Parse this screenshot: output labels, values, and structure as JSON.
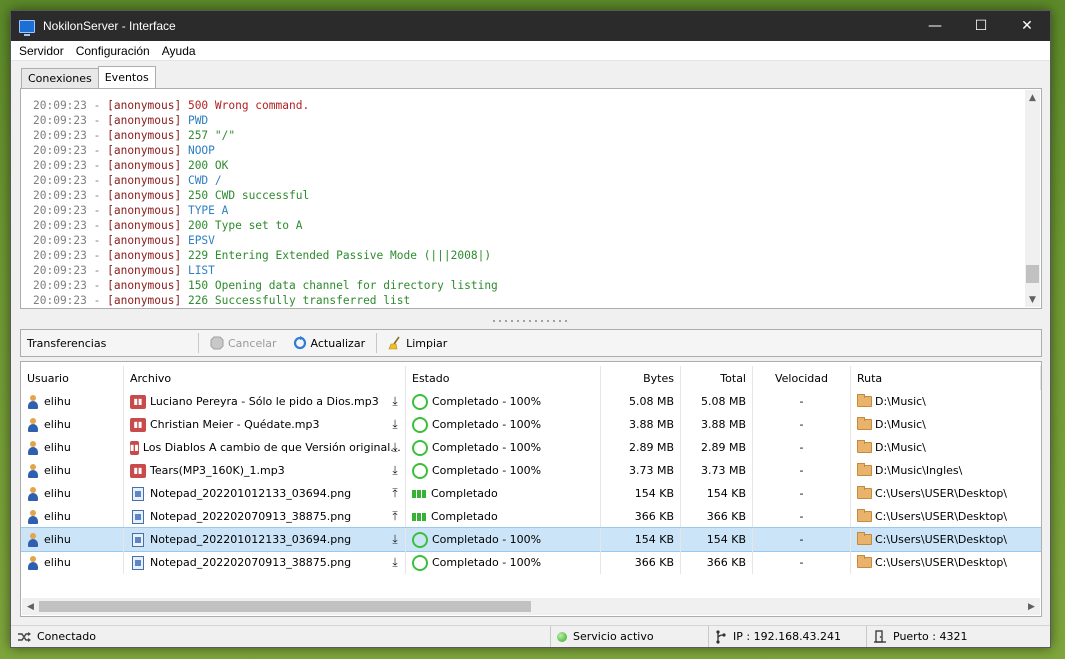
{
  "window": {
    "title": "NokilonServer - Interface",
    "minimize": "—",
    "maximize": "☐",
    "close": "✕"
  },
  "menu": [
    "Servidor",
    "Configuración",
    "Ayuda"
  ],
  "tabs": [
    {
      "label": "Conexiones",
      "active": false
    },
    {
      "label": "Eventos",
      "active": true
    }
  ],
  "log": [
    {
      "time": "20:09:23 -",
      "user": "[anonymous]",
      "msg": "500 Wrong command.",
      "kind": "err"
    },
    {
      "time": "20:09:23 -",
      "user": "[anonymous]",
      "msg": "PWD",
      "kind": "cmd"
    },
    {
      "time": "20:09:23 -",
      "user": "[anonymous]",
      "msg": "257 \"/\"",
      "kind": "ok"
    },
    {
      "time": "20:09:23 -",
      "user": "[anonymous]",
      "msg": "NOOP",
      "kind": "cmd"
    },
    {
      "time": "20:09:23 -",
      "user": "[anonymous]",
      "msg": "200 OK",
      "kind": "ok"
    },
    {
      "time": "20:09:23 -",
      "user": "[anonymous]",
      "msg": "CWD /",
      "kind": "cmd"
    },
    {
      "time": "20:09:23 -",
      "user": "[anonymous]",
      "msg": "250 CWD successful",
      "kind": "ok"
    },
    {
      "time": "20:09:23 -",
      "user": "[anonymous]",
      "msg": "TYPE A",
      "kind": "cmd"
    },
    {
      "time": "20:09:23 -",
      "user": "[anonymous]",
      "msg": "200 Type set to A",
      "kind": "ok"
    },
    {
      "time": "20:09:23 -",
      "user": "[anonymous]",
      "msg": "EPSV",
      "kind": "cmd"
    },
    {
      "time": "20:09:23 -",
      "user": "[anonymous]",
      "msg": "229 Entering Extended Passive Mode (|||2008|)",
      "kind": "ok"
    },
    {
      "time": "20:09:23 -",
      "user": "[anonymous]",
      "msg": "LIST",
      "kind": "cmd"
    },
    {
      "time": "20:09:23 -",
      "user": "[anonymous]",
      "msg": "150 Opening data channel for directory listing",
      "kind": "ok"
    },
    {
      "time": "20:09:23 -",
      "user": "[anonymous]",
      "msg": "226 Successfully transferred list",
      "kind": "ok"
    }
  ],
  "transfers_toolbar": {
    "title": "Transferencias",
    "cancel": "Cancelar",
    "refresh": "Actualizar",
    "clear": "Limpiar"
  },
  "columns": {
    "user": "Usuario",
    "file": "Archivo",
    "state": "Estado",
    "bytes": "Bytes",
    "total": "Total",
    "speed": "Velocidad",
    "path": "Ruta"
  },
  "transfers": [
    {
      "user": "elihu",
      "file": "Luciano Pereyra - Sólo le pido a Dios.mp3",
      "type": "mp3",
      "dir": "down",
      "state": "Completado - 100%",
      "state_icon": "circle",
      "bytes": "5.08 MB",
      "total": "5.08 MB",
      "speed": "-",
      "path": "D:\\Music\\",
      "selected": false
    },
    {
      "user": "elihu",
      "file": "Christian Meier - Quédate.mp3",
      "type": "mp3",
      "dir": "down",
      "state": "Completado - 100%",
      "state_icon": "circle",
      "bytes": "3.88 MB",
      "total": "3.88 MB",
      "speed": "-",
      "path": "D:\\Music\\",
      "selected": false
    },
    {
      "user": "elihu",
      "file": "Los Diablos  A cambio de que  Versión original...",
      "type": "mp3",
      "dir": "down",
      "state": "Completado - 100%",
      "state_icon": "circle",
      "bytes": "2.89 MB",
      "total": "2.89 MB",
      "speed": "-",
      "path": "D:\\Music\\",
      "selected": false
    },
    {
      "user": "elihu",
      "file": "Tears(MP3_160K)_1.mp3",
      "type": "mp3",
      "dir": "down",
      "state": "Completado - 100%",
      "state_icon": "circle",
      "bytes": "3.73 MB",
      "total": "3.73 MB",
      "speed": "-",
      "path": "D:\\Music\\Ingles\\",
      "selected": false
    },
    {
      "user": "elihu",
      "file": "Notepad_202201012133_03694.png",
      "type": "png",
      "dir": "up",
      "state": "Completado",
      "state_icon": "bars",
      "bytes": "154 KB",
      "total": "154 KB",
      "speed": "-",
      "path": "C:\\Users\\USER\\Desktop\\",
      "selected": false
    },
    {
      "user": "elihu",
      "file": "Notepad_202202070913_38875.png",
      "type": "png",
      "dir": "up",
      "state": "Completado",
      "state_icon": "bars",
      "bytes": "366 KB",
      "total": "366 KB",
      "speed": "-",
      "path": "C:\\Users\\USER\\Desktop\\",
      "selected": false
    },
    {
      "user": "elihu",
      "file": "Notepad_202201012133_03694.png",
      "type": "png",
      "dir": "down",
      "state": "Completado - 100%",
      "state_icon": "circle",
      "bytes": "154 KB",
      "total": "154 KB",
      "speed": "-",
      "path": "C:\\Users\\USER\\Desktop\\",
      "selected": true
    },
    {
      "user": "elihu",
      "file": "Notepad_202202070913_38875.png",
      "type": "png",
      "dir": "down",
      "state": "Completado - 100%",
      "state_icon": "circle",
      "bytes": "366 KB",
      "total": "366 KB",
      "speed": "-",
      "path": "C:\\Users\\USER\\Desktop\\",
      "selected": false
    }
  ],
  "statusbar": {
    "connection": "Conectado",
    "service": "Servicio activo",
    "ip": "IP : 192.168.43.241",
    "port": "Puerto : 4321"
  },
  "colors": {
    "titlebar": "#2b2b2b",
    "selection": "#cce4f7",
    "log_ok": "#2e8b2e",
    "log_cmd": "#2f7fc1",
    "log_err": "#b22222"
  }
}
